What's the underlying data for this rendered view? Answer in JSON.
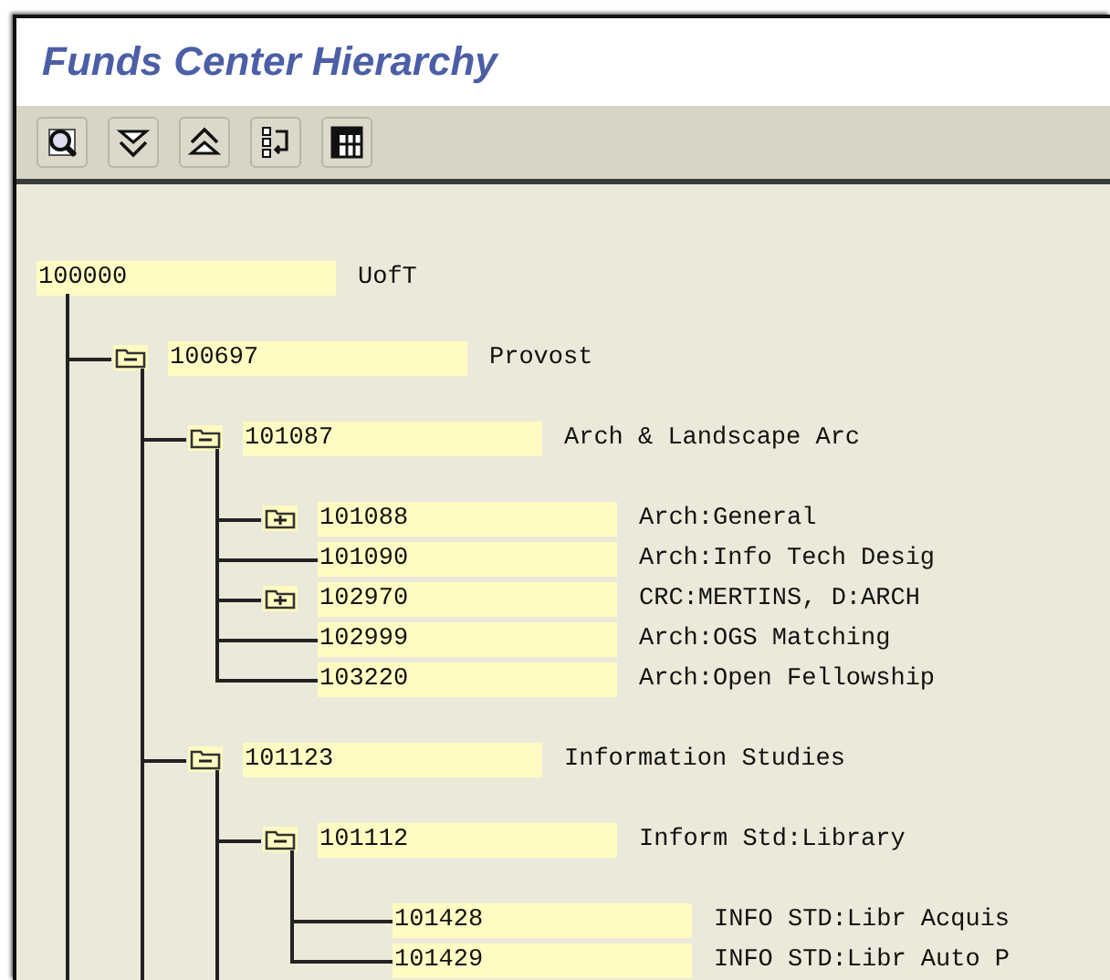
{
  "window": {
    "title": "Funds Center Hierarchy"
  },
  "toolbar": [
    {
      "kind": "find"
    },
    {
      "kind": "expand"
    },
    {
      "kind": "collapse"
    },
    {
      "kind": "layout"
    },
    {
      "kind": "columns"
    }
  ],
  "tree": {
    "id": "100000",
    "description": "UofT",
    "expanded": true,
    "children": [
      {
        "id": "100697",
        "description": "Provost",
        "expanded": true,
        "continues": true,
        "children": [
          {
            "id": "101087",
            "description": "Arch & Landscape Arc",
            "expanded": true,
            "children": [
              {
                "id": "101088",
                "description": "Arch:General",
                "expanded": false
              },
              {
                "id": "101090",
                "description": "Arch:Info Tech Desig"
              },
              {
                "id": "102970",
                "description": "CRC:MERTINS, D:ARCH",
                "expanded": false
              },
              {
                "id": "102999",
                "description": "Arch:OGS Matching"
              },
              {
                "id": "103220",
                "description": "Arch:Open Fellowship"
              }
            ]
          },
          {
            "id": "101123",
            "description": "Information Studies",
            "expanded": true,
            "continues": true,
            "children": [
              {
                "id": "101112",
                "description": "Inform Std:Library",
                "expanded": true,
                "continues": true,
                "children": [
                  {
                    "id": "101428",
                    "description": "INFO STD:Libr Acquis"
                  },
                  {
                    "id": "101429",
                    "description": "INFO STD:Libr Auto P"
                  }
                ]
              }
            ]
          }
        ]
      }
    ]
  }
}
